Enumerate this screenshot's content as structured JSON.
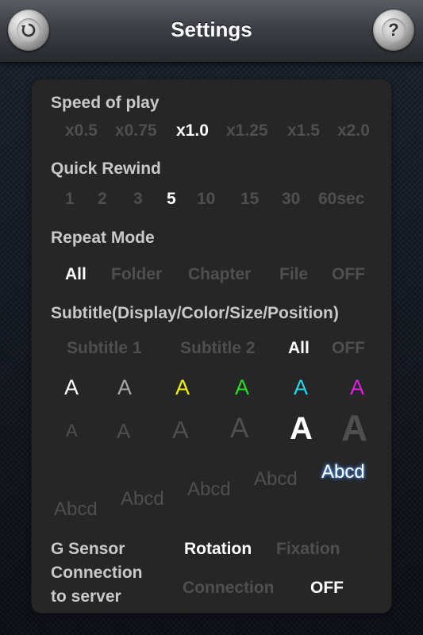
{
  "header": {
    "title": "Settings",
    "back_icon": "rotate-back-icon",
    "help_glyph": "?"
  },
  "speed": {
    "label": "Speed of play",
    "options": [
      "x0.5",
      "x0.75",
      "x1.0",
      "x1.25",
      "x1.5",
      "x2.0"
    ],
    "selected": "x1.0"
  },
  "rewind": {
    "label": "Quick Rewind",
    "options": [
      "1",
      "2",
      "3",
      "5",
      "10",
      "15",
      "30",
      "60sec"
    ],
    "selected": "5"
  },
  "repeat": {
    "label": "Repeat Mode",
    "options": [
      "All",
      "Folder",
      "Chapter",
      "File",
      "OFF"
    ],
    "selected": "All"
  },
  "subtitle": {
    "label": "Subtitle(Display/Color/Size/Position)",
    "display_options": [
      "Subtitle 1",
      "Subtitle 2",
      "All",
      "OFF"
    ],
    "display_selected": "All",
    "colors": [
      {
        "glyph": "A",
        "color": "#ffffff"
      },
      {
        "glyph": "A",
        "color": "#a8a8a8"
      },
      {
        "glyph": "A",
        "color": "#f2f200"
      },
      {
        "glyph": "A",
        "color": "#22e022"
      },
      {
        "glyph": "A",
        "color": "#22d8e8"
      },
      {
        "glyph": "A",
        "color": "#e020e0"
      }
    ],
    "size_glyph": "A",
    "position_sample": "Abcd"
  },
  "gsensor": {
    "label": "G Sensor",
    "options": [
      "Rotation",
      "Fixation"
    ],
    "selected": "Rotation"
  },
  "connection": {
    "label_line1": "Connection",
    "label_line2": "to server",
    "options": [
      "Connection",
      "OFF"
    ],
    "selected": "OFF"
  },
  "colors": {
    "selected_text": "#ffffff",
    "unselected_text": "#4f4f4f",
    "label_text": "#c9c9c9",
    "panel_bg": "#262626"
  }
}
